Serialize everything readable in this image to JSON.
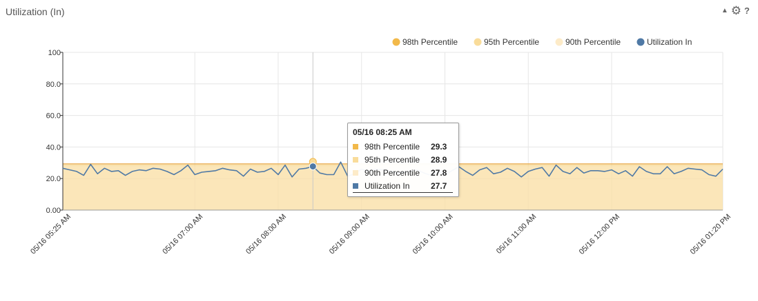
{
  "panel": {
    "title": "Utilization (In)",
    "collapse_icon": "triangle-up-icon",
    "settings_icon": "gear-icon",
    "help_icon": "question-icon"
  },
  "chart_data": {
    "type": "line",
    "title": "",
    "xlabel": "",
    "ylabel": "",
    "ylim": [
      0,
      100
    ],
    "yticks": [
      "0.00",
      "20.0",
      "40.0",
      "60.0",
      "80.0",
      "100"
    ],
    "ytick_values": [
      0,
      20,
      40,
      60,
      80,
      100
    ],
    "xlim_minutes": [
      325,
      800
    ],
    "xticks": [
      {
        "label": "05/16 05:25 AM",
        "minute": 325
      },
      {
        "label": "05/16 07:00 AM",
        "minute": 420
      },
      {
        "label": "05/16 08:00 AM",
        "minute": 480
      },
      {
        "label": "05/16 09:00 AM",
        "minute": 540
      },
      {
        "label": "05/16 10:00 AM",
        "minute": 600
      },
      {
        "label": "05/16 11:00 AM",
        "minute": 660
      },
      {
        "label": "05/16 12:00 PM",
        "minute": 720
      },
      {
        "label": "05/16 01:20 PM",
        "minute": 800
      }
    ],
    "grid": true,
    "legend": "top-right",
    "series": [
      {
        "name": "98th Percentile",
        "color": "#f2b94a",
        "constant": 29.3
      },
      {
        "name": "95th Percentile",
        "color": "#f9dc9a",
        "constant": 28.9
      },
      {
        "name": "90th Percentile",
        "color": "#fdebc8",
        "constant": 27.8
      },
      {
        "name": "Utilization In",
        "color": "#4f79a5",
        "x_start_minute": 325,
        "x_step_minutes": 5,
        "values": [
          26.5,
          25.5,
          24.5,
          22.0,
          29.0,
          23.0,
          26.5,
          24.5,
          25.0,
          22.0,
          24.5,
          25.5,
          25.0,
          26.5,
          26.0,
          24.5,
          22.5,
          25.0,
          28.5,
          22.5,
          24.0,
          24.5,
          25.0,
          26.5,
          25.5,
          25.0,
          21.5,
          26.0,
          24.0,
          24.5,
          26.5,
          22.5,
          28.5,
          21.0,
          26.0,
          26.5,
          27.7,
          23.5,
          22.5,
          22.5,
          30.5,
          21.5,
          23.0,
          26.0,
          24.5,
          26.0,
          25.5,
          25.0,
          23.5,
          24.0,
          24.5,
          25.5,
          23.5,
          22.0,
          24.5,
          22.5,
          25.0,
          27.5,
          24.5,
          22.0,
          25.5,
          27.0,
          23.0,
          24.0,
          26.5,
          24.5,
          21.0,
          24.5,
          26.0,
          27.0,
          21.5,
          28.5,
          24.5,
          23.0,
          27.0,
          23.5,
          25.0,
          25.0,
          24.5,
          25.5,
          23.0,
          25.0,
          21.5,
          27.5,
          24.5,
          23.0,
          23.0,
          27.5,
          23.0,
          24.5,
          26.5,
          26.0,
          25.5,
          22.5,
          21.5,
          26.0
        ]
      }
    ],
    "hover": {
      "time_label": "05/16 08:25 AM",
      "minute": 505,
      "rows": [
        {
          "name": "98th Percentile",
          "value": "29.3",
          "color": "#f2b94a"
        },
        {
          "name": "95th Percentile",
          "value": "28.9",
          "color": "#f9dc9a"
        },
        {
          "name": "90th Percentile",
          "value": "27.8",
          "color": "#fdebc8"
        },
        {
          "name": "Utilization In",
          "value": "27.7",
          "color": "#4f79a5"
        }
      ]
    }
  }
}
